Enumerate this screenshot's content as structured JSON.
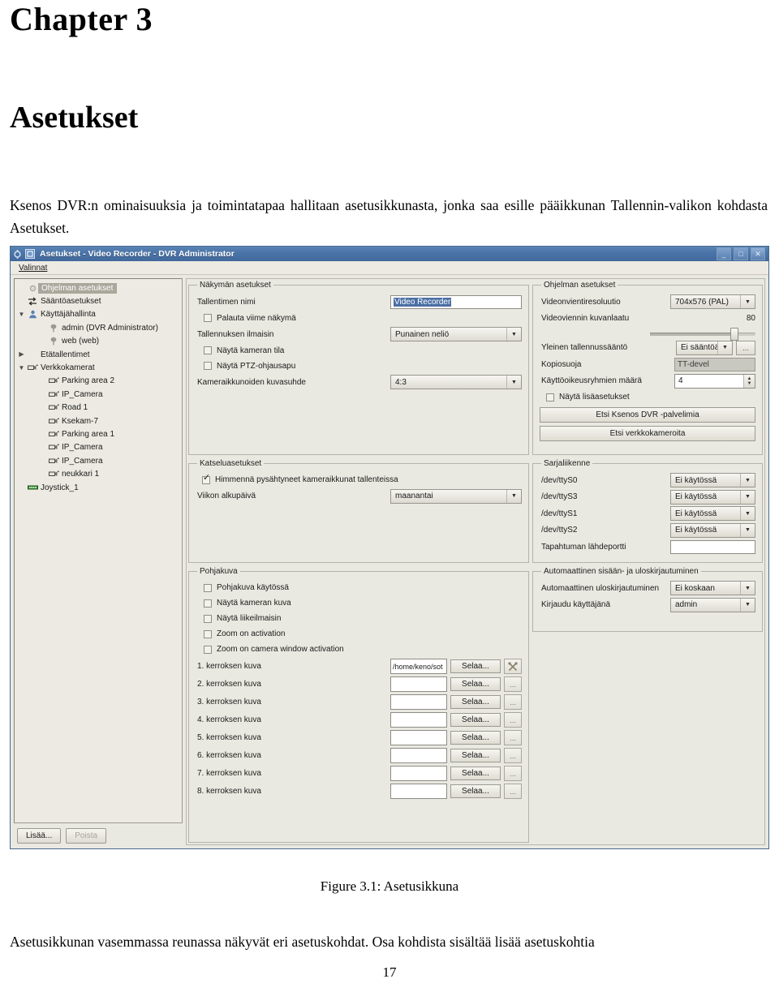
{
  "document": {
    "chapter_number": "Chapter 3",
    "chapter_title": "Asetukset",
    "intro_paragraph": "Ksenos DVR:n ominaisuuksia ja toimintatapaa hallitaan asetusikkunasta, jonka saa esille pääikkunan Tallennin-valikon kohdasta Asetukset.",
    "figure_caption": "Figure 3.1: Asetusikkuna",
    "after_figure_paragraph": "Asetusikkunan vasemmassa reunassa näkyvät eri asetuskohdat.  Osa kohdista sisältää lisää asetuskohtia",
    "page_number": "17"
  },
  "window": {
    "title": "Asetukset - Video Recorder - DVR Administrator",
    "titlebar_color": "#4a74a8",
    "controls": {
      "minimize": "_",
      "maximize": "□",
      "close": "✕"
    },
    "menubar": {
      "items": [
        {
          "label": "Valinnat",
          "mnemonic": "V"
        }
      ]
    }
  },
  "tree": {
    "items": [
      {
        "label": "Ohjelman asetukset",
        "icon": "gear-icon",
        "indent": 1,
        "twisty": "",
        "selected": true
      },
      {
        "label": "Sääntöasetukset",
        "icon": "rules-icon",
        "indent": 1,
        "twisty": "",
        "selected": false
      },
      {
        "label": "Käyttäjähallinta",
        "icon": "user-icon",
        "indent": 1,
        "twisty": "▼",
        "selected": false
      },
      {
        "label": "admin (DVR Administrator)",
        "icon": "key-icon",
        "indent": 2,
        "twisty": "",
        "selected": false
      },
      {
        "label": "web (web)",
        "icon": "key-icon",
        "indent": 2,
        "twisty": "",
        "selected": false
      },
      {
        "label": "Etätallentimet",
        "icon": "",
        "indent": 1,
        "twisty": "▶",
        "selected": false
      },
      {
        "label": "Verkkokamerat",
        "icon": "camera-icon",
        "indent": 1,
        "twisty": "▼",
        "selected": false
      },
      {
        "label": "Parking area 2",
        "icon": "camera-icon",
        "indent": 2,
        "twisty": "",
        "selected": false
      },
      {
        "label": "IP_Camera",
        "icon": "camera-icon",
        "indent": 2,
        "twisty": "",
        "selected": false
      },
      {
        "label": "Road 1",
        "icon": "camera-icon",
        "indent": 2,
        "twisty": "",
        "selected": false
      },
      {
        "label": "Ksekam-7",
        "icon": "camera-icon",
        "indent": 2,
        "twisty": "",
        "selected": false
      },
      {
        "label": "Parking area 1",
        "icon": "camera-icon",
        "indent": 2,
        "twisty": "",
        "selected": false
      },
      {
        "label": "IP_Camera",
        "icon": "camera-icon",
        "indent": 2,
        "twisty": "",
        "selected": false
      },
      {
        "label": "IP_Camera",
        "icon": "camera-icon",
        "indent": 2,
        "twisty": "",
        "selected": false
      },
      {
        "label": "neukkari 1",
        "icon": "camera-icon",
        "indent": 2,
        "twisty": "",
        "selected": false
      },
      {
        "label": "Joystick_1",
        "icon": "joystick-icon",
        "indent": 1,
        "twisty": "",
        "selected": false
      }
    ],
    "add_button": "Lisää...",
    "remove_button": "Poista"
  },
  "view_settings": {
    "legend": "Näkymän asetukset",
    "recorder_name_label": "Tallentimen nimi",
    "recorder_name_value": "Video Recorder",
    "restore_last_view": "Palauta viime näkymä",
    "restore_last_view_checked": false,
    "recording_indicator_label": "Tallennuksen ilmaisin",
    "recording_indicator_value": "Punainen neliö",
    "show_camera_state": "Näytä kameran tila",
    "show_camera_state_checked": false,
    "show_ptz_help": "Näytä PTZ-ohjausapu",
    "show_ptz_help_checked": false,
    "aspect_ratio_label": "Kameraikkunoiden kuvasuhde",
    "aspect_ratio_value": "4:3"
  },
  "program_settings": {
    "legend": "Ohjelman asetukset",
    "export_resolution_label": "Videonvientiresoluutio",
    "export_resolution_value": "704x576 (PAL)",
    "export_quality_label": "Videoviennin kuvanlaatu",
    "export_quality_value": "80",
    "general_rule_label": "Yleinen tallennussääntö",
    "general_rule_value": "Ei sääntöä",
    "general_rule_more": "...",
    "copy_protection_label": "Kopiosuoja",
    "copy_protection_value": "TT-devel",
    "permission_groups_label": "Käyttöoikeusryhmien määrä",
    "permission_groups_value": "4",
    "show_advanced": "Näytä lisäasetukset",
    "show_advanced_checked": false,
    "find_servers_button": "Etsi Ksenos DVR -palvelimia",
    "find_cameras_button": "Etsi verkkokameroita"
  },
  "viewing_settings": {
    "legend": "Katseluasetukset",
    "dim_stopped_label": "Himmennä pysähtyneet kameraikkunat tallenteissa",
    "dim_stopped_checked": true,
    "week_start_label": "Viikon alkupäivä",
    "week_start_value": "maanantai"
  },
  "serial": {
    "legend": "Sarjaliikenne",
    "ports": [
      {
        "device": "/dev/ttyS0",
        "value": "Ei käytössä"
      },
      {
        "device": "/dev/ttyS3",
        "value": "Ei käytössä"
      },
      {
        "device": "/dev/ttyS1",
        "value": "Ei käytössä"
      },
      {
        "device": "/dev/ttyS2",
        "value": "Ei käytössä"
      }
    ],
    "event_source_label": "Tapahtuman lähdeportti",
    "event_source_value": ""
  },
  "auto_login": {
    "legend": "Automaattinen sisään- ja uloskirjautuminen",
    "auto_logout_label": "Automaattinen uloskirjautuminen",
    "auto_logout_value": "Ei koskaan",
    "login_as_label": "Kirjaudu käyttäjänä",
    "login_as_value": "admin"
  },
  "floorplan": {
    "legend": "Pohjakuva",
    "checkboxes": [
      {
        "label": "Pohjakuva käytössä",
        "checked": false
      },
      {
        "label": "Näytä kameran kuva",
        "checked": false
      },
      {
        "label": "Näytä liikeilmaisin",
        "checked": false
      },
      {
        "label": "Zoom on activation",
        "checked": false
      },
      {
        "label": "Zoom on camera window activation",
        "checked": false
      }
    ],
    "browse_label": "Selaa...",
    "edit_label": "...",
    "layers": [
      {
        "label": "1. kerroksen kuva",
        "path": "/home/keno/sot",
        "edit_icon": "crossed-tools-icon"
      },
      {
        "label": "2. kerroksen kuva",
        "path": "",
        "edit_icon": ""
      },
      {
        "label": "3. kerroksen kuva",
        "path": "",
        "edit_icon": ""
      },
      {
        "label": "4. kerroksen kuva",
        "path": "",
        "edit_icon": ""
      },
      {
        "label": "5. kerroksen kuva",
        "path": "",
        "edit_icon": ""
      },
      {
        "label": "6. kerroksen kuva",
        "path": "",
        "edit_icon": ""
      },
      {
        "label": "7. kerroksen kuva",
        "path": "",
        "edit_icon": ""
      },
      {
        "label": "8. kerroksen kuva",
        "path": "",
        "edit_icon": ""
      }
    ]
  }
}
